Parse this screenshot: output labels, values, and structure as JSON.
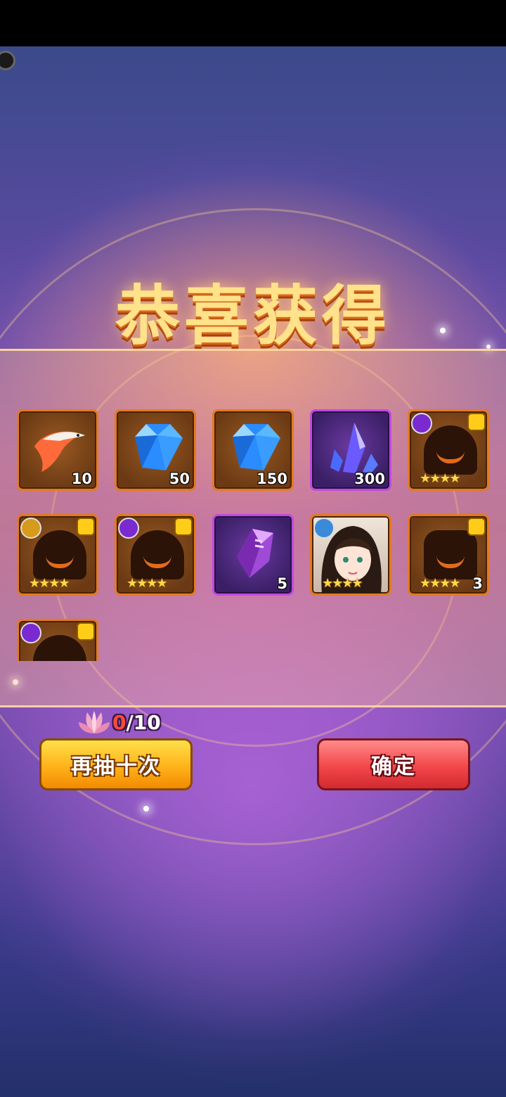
{
  "title": "恭喜获得",
  "items": [
    {
      "name": "koi-fish-item",
      "quantity": "10",
      "frame": "orange"
    },
    {
      "name": "blue-diamond-item",
      "quantity": "50",
      "frame": "orange"
    },
    {
      "name": "blue-diamond-item",
      "quantity": "150",
      "frame": "orange"
    },
    {
      "name": "purple-crystal-item",
      "quantity": "300",
      "frame": "purple"
    },
    {
      "name": "hero-shard-silhouette",
      "stars": "★★★★",
      "element": "purple-moon",
      "frame": "orange"
    },
    {
      "name": "hero-shard-silhouette",
      "stars": "★★★★",
      "element": "sun",
      "frame": "orange"
    },
    {
      "name": "hero-shard-silhouette",
      "stars": "★★★★",
      "element": "purple-moon",
      "frame": "orange"
    },
    {
      "name": "purple-rune-crystal",
      "quantity": "5",
      "frame": "purple"
    },
    {
      "name": "hero-portrait-girl",
      "stars": "★★★★",
      "element": "blue",
      "frame": "orange"
    },
    {
      "name": "hero-shard-silhouette-horned",
      "stars": "★★★★",
      "quantity": "3",
      "frame": "orange"
    },
    {
      "name": "hero-shard-silhouette",
      "element": "purple-moon",
      "frame": "orange"
    }
  ],
  "counter": {
    "current": "0",
    "total": "/10"
  },
  "buttons": {
    "draw_again": "再抽十次",
    "confirm": "确定"
  },
  "colors": {
    "accent_gold": "#ffe28a",
    "frame_orange": "#e37a20",
    "frame_purple": "#c04ae0",
    "button_yellow": "#ffb21a",
    "button_red": "#f2474a"
  }
}
